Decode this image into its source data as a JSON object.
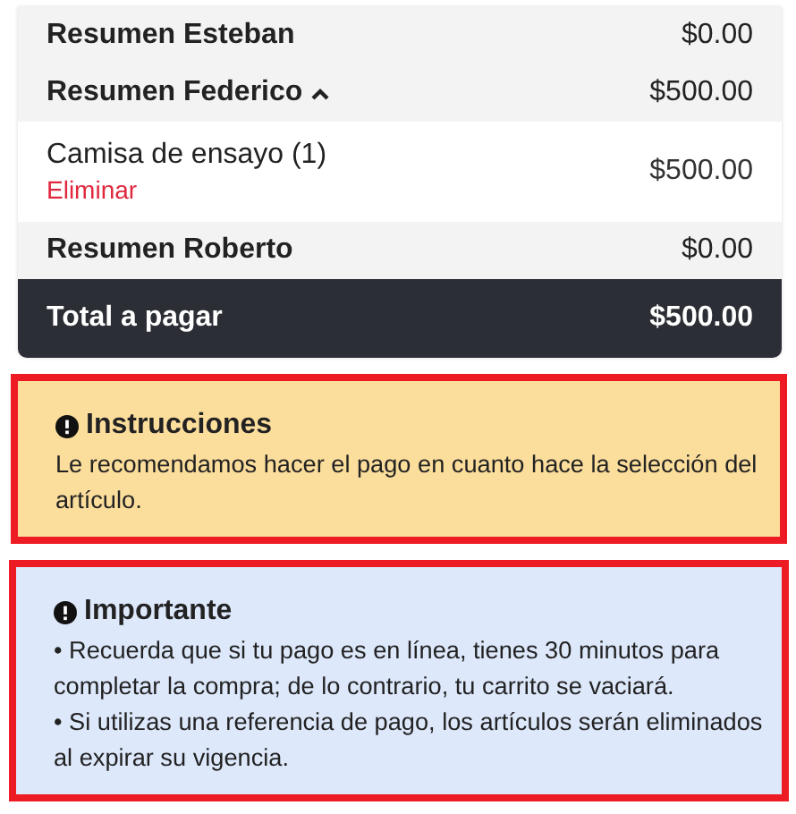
{
  "summary": {
    "rows": [
      {
        "kind": "group",
        "label": "Resumen Esteban",
        "amount": "$0.00",
        "expanded": false
      },
      {
        "kind": "group",
        "label": "Resumen Federico",
        "amount": "$500.00",
        "expanded": true
      },
      {
        "kind": "item",
        "label": "Camisa de ensayo (1)",
        "action": "Eliminar",
        "amount": "$500.00"
      },
      {
        "kind": "group",
        "label": "Resumen Roberto",
        "amount": "$0.00",
        "expanded": false
      }
    ],
    "total": {
      "label": "Total a pagar",
      "amount": "$500.00"
    }
  },
  "notices": [
    {
      "kind": "warning",
      "title": "Instrucciones",
      "lines": [
        "Le recomendamos hacer el pago en cuanto hace la selección del artículo."
      ]
    },
    {
      "kind": "info",
      "title": "Importante",
      "lines": [
        "• Recuerda que si tu pago es en línea, tienes 30 minutos para completar la compra; de lo contrario, tu carrito se vaciará.",
        "• Si utilizas una referencia de pago, los artículos serán eliminados al expirar su vigencia."
      ]
    }
  ]
}
